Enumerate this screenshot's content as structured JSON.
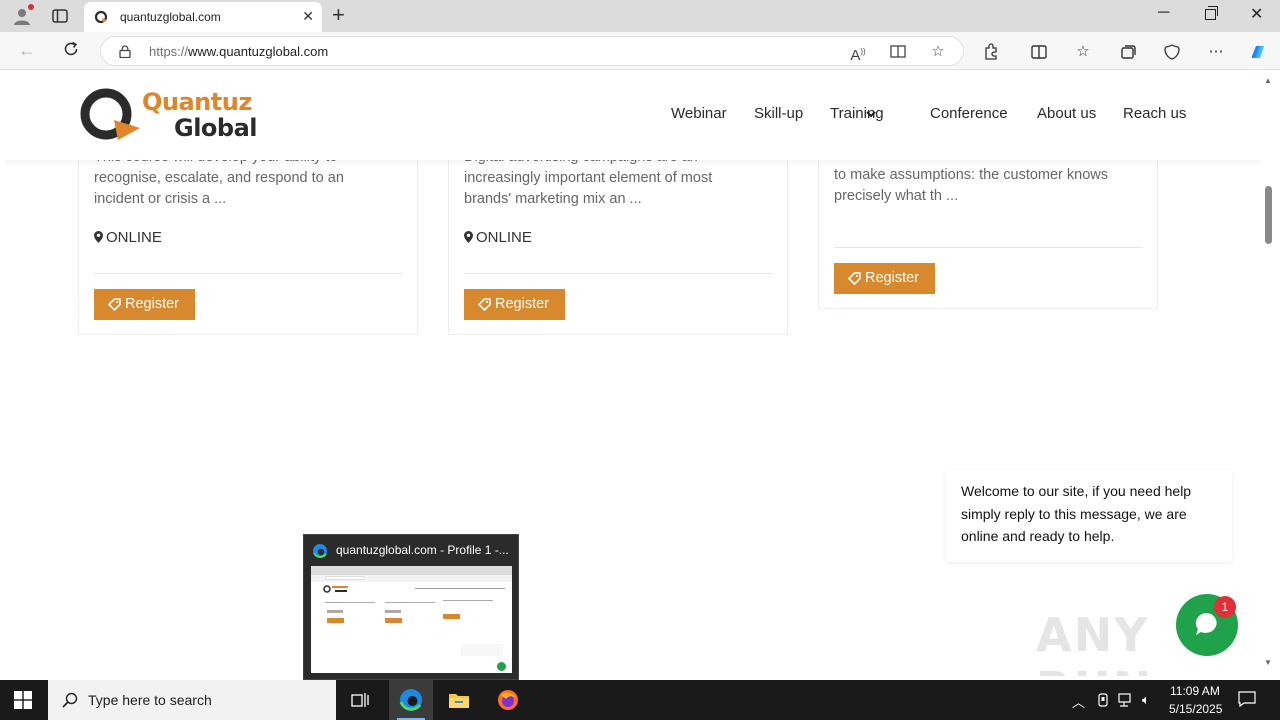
{
  "browser": {
    "tab_title": "quantuzglobal.com",
    "new_tab_symbol": "+",
    "close_symbol": "✕",
    "url_prefix": "https://",
    "url_host": "www.quantuzglobal.com",
    "back_symbol": "←"
  },
  "site": {
    "logo_line1": "Quantuz",
    "logo_line2": "Global",
    "nav": [
      "Webinar",
      "Skill-up",
      "Training",
      "Conference",
      "About us",
      "Reach us"
    ]
  },
  "cards": [
    {
      "desc_cut": "This course will develop your ability to",
      "desc_lines": [
        "recognise, escalate, and respond to an",
        "incident or crisis a ..."
      ],
      "location": "ONLINE",
      "button": "Register"
    },
    {
      "desc_cut": "Digital advertising campaigns are an",
      "desc_lines": [
        "increasingly important element of most",
        "brands' marketing mix an ..."
      ],
      "location": "ONLINE",
      "button": "Register"
    },
    {
      "desc_cut": "...",
      "desc_lines": [
        "to make assumptions: the customer knows",
        "precisely what th ..."
      ],
      "button": "Register"
    }
  ],
  "chat": {
    "message": "Welcome to our site, if you need help simply reply to this message, we are online and ready to help.",
    "badge_count": "1"
  },
  "watermark": "ANY RUN",
  "taskbar": {
    "preview_title": "quantuzglobal.com - Profile 1 -...",
    "search_placeholder": "Type here to search",
    "clock_time": "11:09 AM",
    "clock_date": "5/15/2025"
  },
  "colors": {
    "brand_orange": "#d9892d",
    "chat_green": "#1fa24a",
    "badge_red": "#e0313b"
  }
}
